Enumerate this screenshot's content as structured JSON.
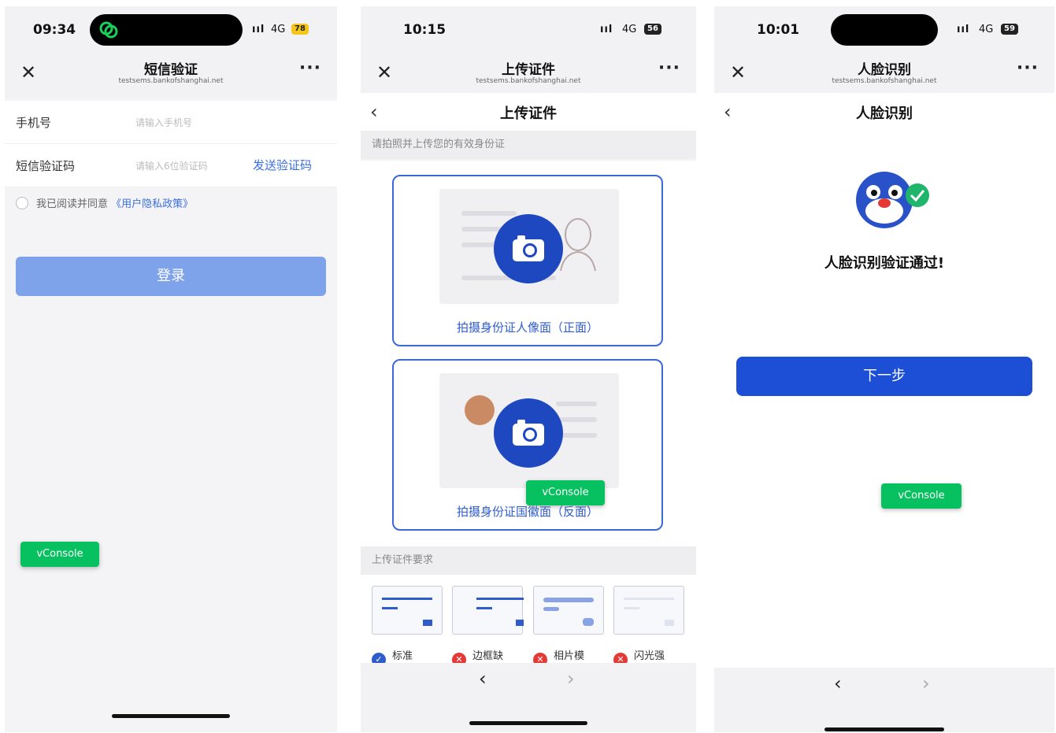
{
  "panel1": {
    "status": {
      "time": "09:34",
      "signal": "ııl",
      "network": "4G",
      "battery": "78"
    },
    "nav": {
      "title": "短信验证",
      "url": "testsems.bankofshanghai.net",
      "close": "✕",
      "more": "···"
    },
    "form": {
      "phone_label": "手机号",
      "phone_placeholder": "请输入手机号",
      "code_label": "短信验证码",
      "code_placeholder": "请输入6位验证码",
      "send_code": "发送验证码"
    },
    "agree_text": "我已阅读并同意",
    "policy_link": "《用户隐私政策》",
    "login_button": "登录",
    "vconsole": "vConsole"
  },
  "panel2": {
    "status": {
      "time": "10:15",
      "signal": "ııl",
      "network": "4G",
      "battery": "56"
    },
    "nav": {
      "title": "上传证件",
      "url": "testsems.bankofshanghai.net",
      "close": "✕",
      "more": "···"
    },
    "page_title": "上传证件",
    "back": "‹",
    "hint": "请拍照并上传您的有效身份证",
    "card_front": "拍摄身份证人像面（正面）",
    "card_back": "拍摄身份证国徽面（反面）",
    "req_title": "上传证件要求",
    "requirements": [
      "标准",
      "边框缺",
      "相片模",
      "闪光强"
    ],
    "vconsole": "vConsole",
    "browser_back": "‹",
    "browser_forward": "›"
  },
  "panel3": {
    "status": {
      "time": "10:01",
      "signal": "ııl",
      "network": "4G",
      "battery": "59"
    },
    "nav": {
      "title": "人脸识别",
      "url": "testsems.bankofshanghai.net",
      "close": "✕",
      "more": "···"
    },
    "page_title": "人脸识别",
    "back": "‹",
    "result": "人脸识别验证通过!",
    "next_button": "下一步",
    "vconsole": "vConsole",
    "browser_back": "‹",
    "browser_forward": "›"
  },
  "colors": {
    "primary": "#1d4fd6",
    "link": "#3a6fe0",
    "login_disabled": "#7fa3ea",
    "vconsole": "#07c160",
    "error": "#e53935"
  }
}
